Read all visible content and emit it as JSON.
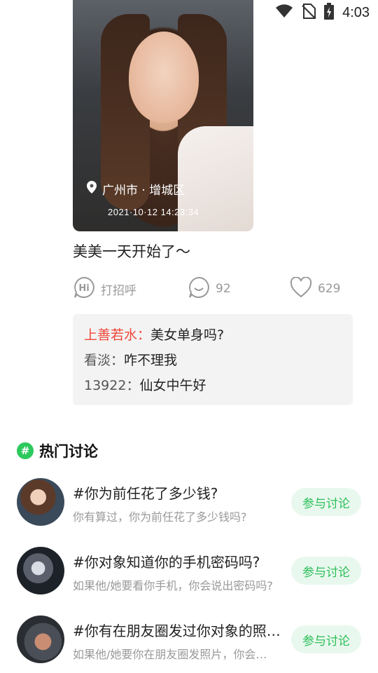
{
  "status_bar": {
    "time": "4:03"
  },
  "post": {
    "location": "广州市 · 增城区",
    "datetime": "2021·10·12  14:23:34",
    "caption": "美美一天开始了～",
    "actions": {
      "greet_label": "打招呼",
      "comment_count": "92",
      "like_count": "629"
    },
    "comments": [
      {
        "user": "上善若水：",
        "text": "美女单身吗?"
      },
      {
        "user": "看淡：",
        "text": "咋不理我"
      },
      {
        "user": "13922：",
        "text": "仙女中午好"
      }
    ]
  },
  "hot_topics": {
    "badge": "#",
    "title": "热门讨论",
    "items": [
      {
        "title": "#你为前任花了多少钱?",
        "desc": "你有算过，你为前任花了多少钱吗?",
        "button": "参与讨论"
      },
      {
        "title": "#你对象知道你的手机密码吗?",
        "desc": "如果他/她要看你手机，你会说出密码吗?",
        "button": "参与讨论"
      },
      {
        "title": "#你有在朋友圈发过你对象的照片吗?",
        "desc": "如果他/她要你在朋友圈发照片，你会发吗?",
        "button": "参与讨论"
      }
    ]
  },
  "colors": {
    "accent": "#2bbf58",
    "highlight_user": "#f0473a",
    "muted": "#999999"
  }
}
